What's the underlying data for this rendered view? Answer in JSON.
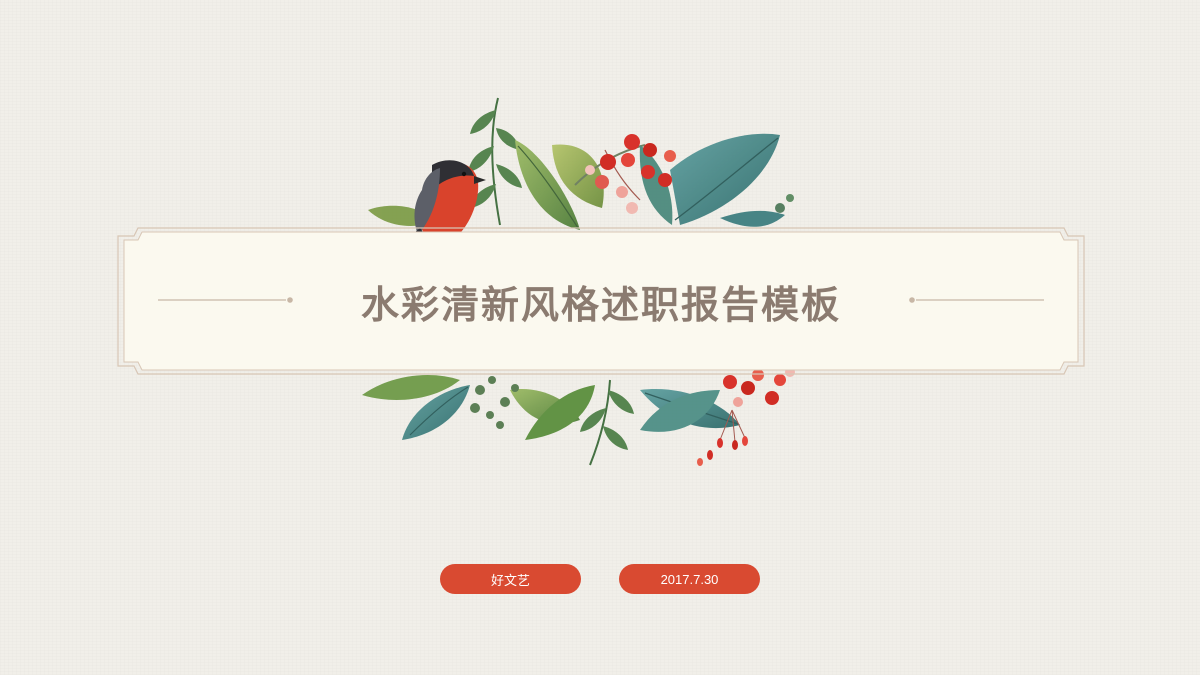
{
  "slide": {
    "title": "水彩清新风格述职报告模板",
    "author": "好文艺",
    "date": "2017.7.30"
  },
  "colors": {
    "background": "#f1efe9",
    "banner_fill": "#fbf9ef",
    "frame_line": "#d8c6b5",
    "title_text": "#8b7b70",
    "pill": "#d94a31",
    "leaf_green": "#5a8a4a",
    "leaf_teal": "#3f7f80",
    "berry_red": "#d8322b",
    "bird_breast": "#d9432c"
  },
  "decor": {
    "illustration": "watercolor-leaves-and-berries",
    "bird": "bird-illustration"
  }
}
